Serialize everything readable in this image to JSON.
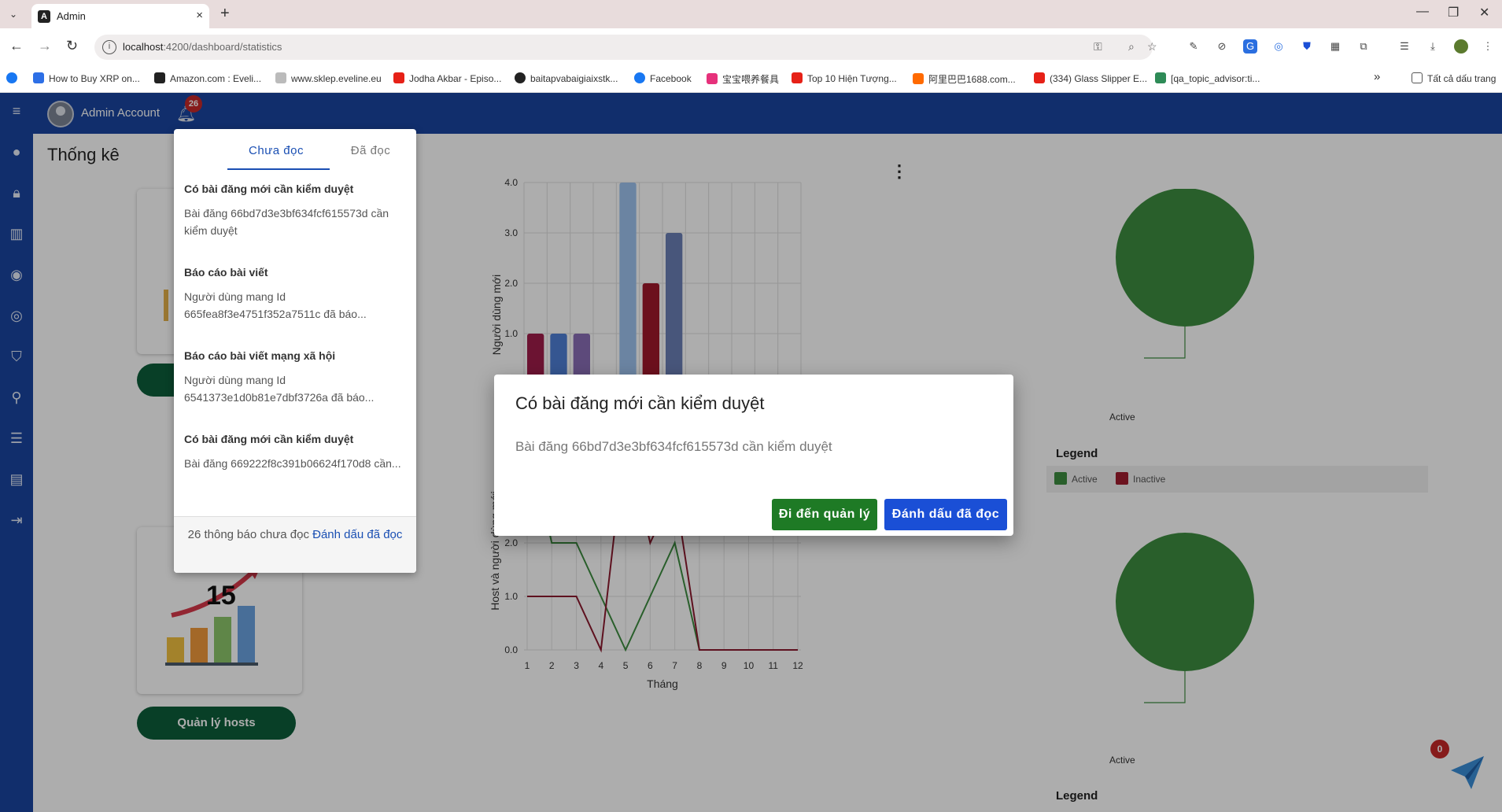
{
  "browser": {
    "tab_title": "Admin",
    "tab_close": "×",
    "new_tab": "+",
    "url_host": "localhost",
    "url_path": ":4200/dashboard/statistics",
    "bookmarks": [
      {
        "label": "How to Buy XRP on...",
        "color": "#2d6fe6"
      },
      {
        "label": "Amazon.com : Eveli...",
        "color": "#222222"
      },
      {
        "label": "www.sklep.eveline.eu",
        "color": "#888888"
      },
      {
        "label": "Jodha Akbar - Episo...",
        "color": "#e62117"
      },
      {
        "label": "baitapvabaigiaixstk...",
        "color": "#222222"
      },
      {
        "label": "Facebook",
        "color": "#1877f2"
      },
      {
        "label": "宝宝喂养餐具",
        "color": "#e6317b"
      },
      {
        "label": "Top 10 Hiện Tượng...",
        "color": "#e62117"
      },
      {
        "label": "阿里巴巴1688.com...",
        "color": "#ff6a00"
      },
      {
        "label": "(334) Glass Slipper E...",
        "color": "#e62117"
      },
      {
        "label": "[qa_topic_advisor:ti...",
        "color": "#2e8b57"
      }
    ],
    "bookmarks_more": "»",
    "all_bookmarks": "Tất cả dấu trang"
  },
  "header": {
    "account_name": "Admin Account",
    "notification_count": "26"
  },
  "page": {
    "title": "Thống kê",
    "manage_hosts_button": "Quản lý hosts",
    "hosts_stat_value": "15"
  },
  "notifications": {
    "tabs": [
      "Chưa đọc",
      "Đã đọc"
    ],
    "items": [
      {
        "title": "Có bài đăng mới cần kiểm duyệt",
        "body": "Bài đăng 66bd7d3e3bf634fcf615573d cần kiểm duyệt"
      },
      {
        "title": "Báo cáo bài viết",
        "body": "Người dùng mang Id 665fea8f3e4751f352a7511c đã báo..."
      },
      {
        "title": "Báo cáo bài viết mạng xã hội",
        "body": "Người dùng mang Id 6541373e1d0b81e7dbf3726a đã báo..."
      },
      {
        "title": "Có bài đăng mới cần kiểm duyệt",
        "body": "Bài đăng 669222f8c391b06624f170d8 cần..."
      }
    ],
    "footer_count": "26 thông báo chưa đọc",
    "footer_mark_all": "Đánh dấu đã đọc"
  },
  "dialog": {
    "title": "Có bài đăng mới cần kiểm duyệt",
    "message": "Bài đăng 66bd7d3e3bf634fcf615573d cần kiểm duyệt",
    "go_to_manage": "Đi đến quản lý",
    "mark_read": "Đánh dấu đã đọc"
  },
  "pie_charts": [
    {
      "label": "Active",
      "legend_title": "Legend",
      "legend": [
        {
          "name": "Active",
          "color": "#3d8c40"
        },
        {
          "name": "Inactive",
          "color": "#a01c2e"
        }
      ]
    },
    {
      "label": "Active",
      "legend_title": "Legend"
    }
  ],
  "chat_badge": "0",
  "colors": {
    "brand_blue": "#1a45a0",
    "button_green": "#1e7a25",
    "button_blue": "#1a4fd6",
    "pill_green": "#0d5e3a"
  },
  "chart_data": [
    {
      "type": "bar",
      "ylabel": "Người dùng mới",
      "ylim": [
        0,
        4
      ],
      "y_ticks": [
        "0.0",
        "1.0",
        "2.0",
        "3.0",
        "4.0"
      ],
      "categories": [
        1,
        2,
        3,
        4,
        5,
        6,
        7,
        8,
        9,
        10,
        11,
        12
      ],
      "values": [
        1,
        1,
        1,
        0,
        4,
        2,
        3,
        0,
        0,
        0,
        0,
        0
      ],
      "bar_colors": [
        "#a01c4a",
        "#4f7fd6",
        "#8a6db5",
        "#888888",
        "#9ec3ef",
        "#a0182c",
        "#6b7fb6",
        "#888888",
        "#888888",
        "#888888",
        "#888888",
        "#888888"
      ]
    },
    {
      "type": "line",
      "xlabel": "Tháng",
      "ylabel": "Host và người dùng mới",
      "ylim": [
        0,
        4
      ],
      "y_ticks": [
        "0.0",
        "1.0",
        "2.0",
        "3.0",
        "4.0"
      ],
      "x": [
        1,
        2,
        3,
        4,
        5,
        6,
        7,
        8,
        9,
        10,
        11,
        12
      ],
      "series": [
        {
          "color": "#3d8c40",
          "values": [
            4,
            2,
            2,
            1,
            0,
            1,
            2,
            0,
            0,
            0,
            0,
            0
          ]
        },
        {
          "color": "#8b1a2e",
          "values": [
            1,
            1,
            1,
            0,
            4,
            2,
            3,
            0,
            0,
            0,
            0,
            0
          ]
        }
      ]
    },
    {
      "type": "pie",
      "categories": [
        "Active",
        "Inactive"
      ],
      "values": [
        1,
        0
      ]
    },
    {
      "type": "pie",
      "categories": [
        "Active"
      ],
      "values": [
        1
      ]
    }
  ]
}
